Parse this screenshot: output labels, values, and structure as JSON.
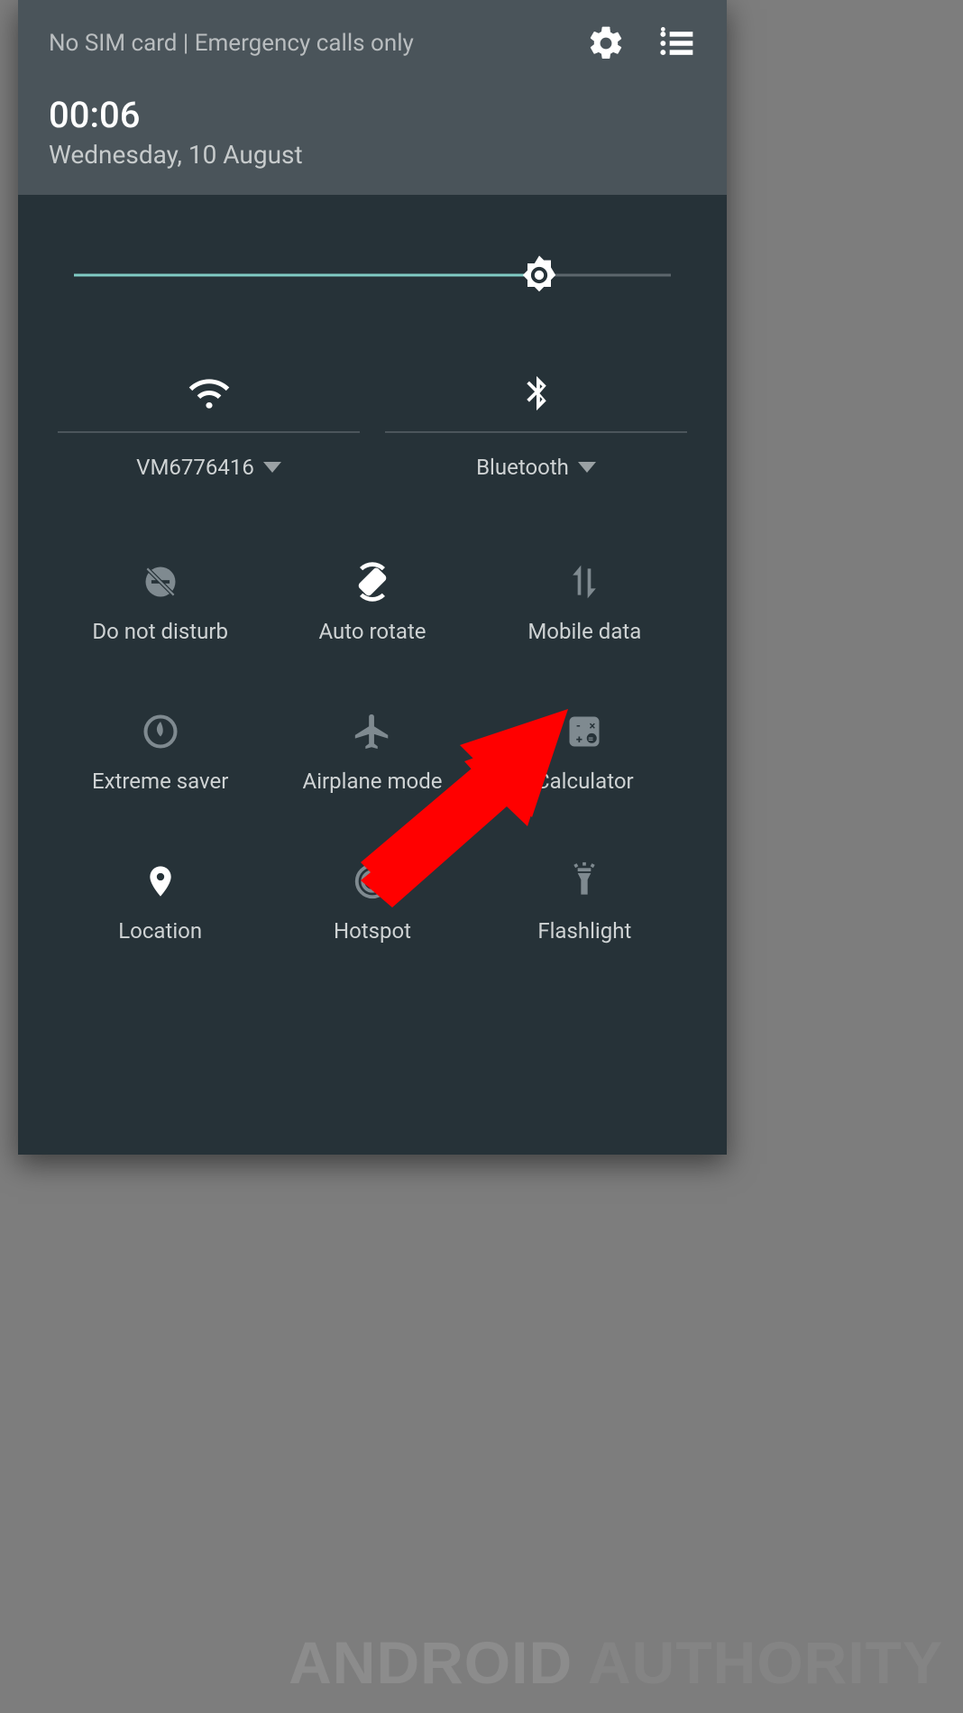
{
  "status": "No SIM card | Emergency calls only",
  "time": "00:06",
  "date": "Wednesday, 10 August",
  "brightness_percent": 78,
  "wide_tiles": [
    {
      "icon": "wifi-icon",
      "label": "VM6776416",
      "active": true
    },
    {
      "icon": "bluetooth-icon",
      "label": "Bluetooth",
      "active": true
    }
  ],
  "tiles": [
    {
      "icon": "dnd-icon",
      "label": "Do not disturb",
      "active": false
    },
    {
      "icon": "auto-rotate-icon",
      "label": "Auto rotate",
      "active": true
    },
    {
      "icon": "mobile-data-icon",
      "label": "Mobile data",
      "active": false
    },
    {
      "icon": "extreme-saver-icon",
      "label": "Extreme saver",
      "active": false
    },
    {
      "icon": "airplane-icon",
      "label": "Airplane mode",
      "active": false
    },
    {
      "icon": "calculator-icon",
      "label": "Calculator",
      "active": false
    },
    {
      "icon": "location-icon",
      "label": "Location",
      "active": true
    },
    {
      "icon": "hotspot-icon",
      "label": "Hotspot",
      "active": false
    },
    {
      "icon": "flashlight-icon",
      "label": "Flashlight",
      "active": false
    }
  ],
  "watermark": {
    "w1": "ANDROID",
    "w2": "AUTHORITY"
  }
}
